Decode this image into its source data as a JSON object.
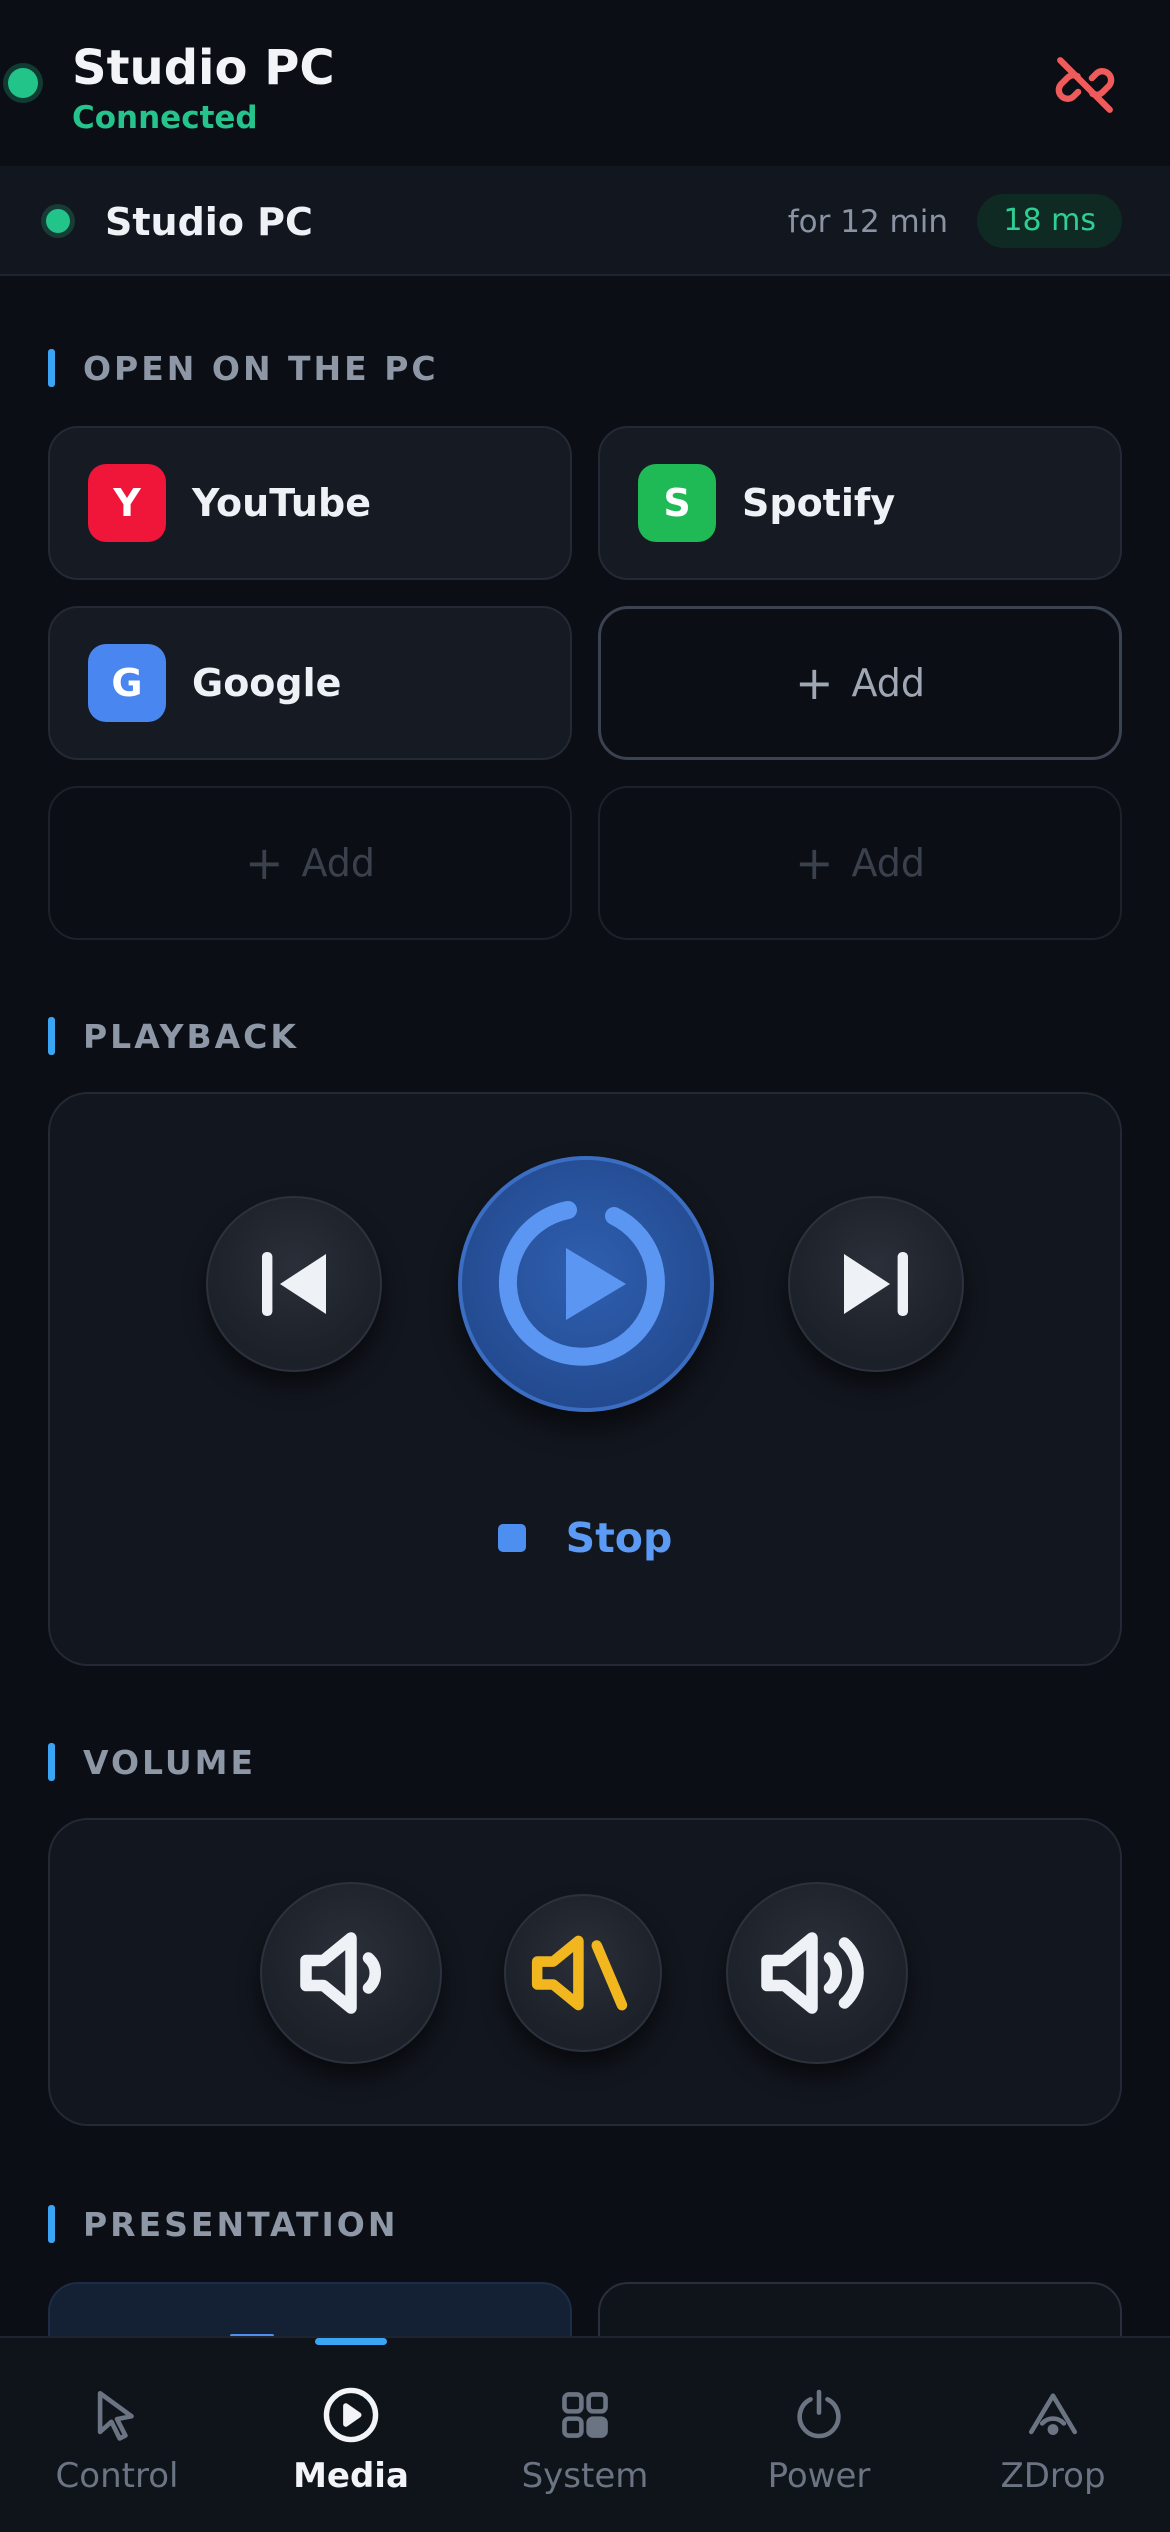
{
  "header": {
    "title": "Studio PC",
    "status": "Connected",
    "status_color": "#25c48d",
    "disconnect_icon": "unlink-icon"
  },
  "device_bar": {
    "name": "Studio PC",
    "uptime": "for 12 min",
    "latency": "18 ms"
  },
  "open_on_pc": {
    "heading": "OPEN ON THE PC",
    "shortcuts": [
      {
        "letter": "Y",
        "name": "YouTube",
        "color": "#f0163a"
      },
      {
        "letter": "S",
        "name": "Spotify",
        "color": "#1fba55"
      },
      {
        "letter": "G",
        "name": "Google",
        "color": "#4a86f0"
      }
    ],
    "add_label": "Add"
  },
  "playback": {
    "heading": "PLAYBACK",
    "controls": [
      "previous-icon",
      "play-icon",
      "next-icon"
    ],
    "stop_label": "Stop"
  },
  "volume": {
    "heading": "VOLUME",
    "controls": [
      "volume-down-icon",
      "mute-icon",
      "volume-up-icon"
    ],
    "mute_color": "#f2b61f"
  },
  "presentation": {
    "heading": "PRESENTATION"
  },
  "nav": {
    "items": [
      {
        "label": "Control",
        "icon": "cursor-icon"
      },
      {
        "label": "Media",
        "icon": "play-circle-icon"
      },
      {
        "label": "System",
        "icon": "grid-icon"
      },
      {
        "label": "Power",
        "icon": "power-icon"
      },
      {
        "label": "ZDrop",
        "icon": "zdrop-icon"
      }
    ],
    "active": "Media",
    "accent": "#3aa5f5"
  }
}
